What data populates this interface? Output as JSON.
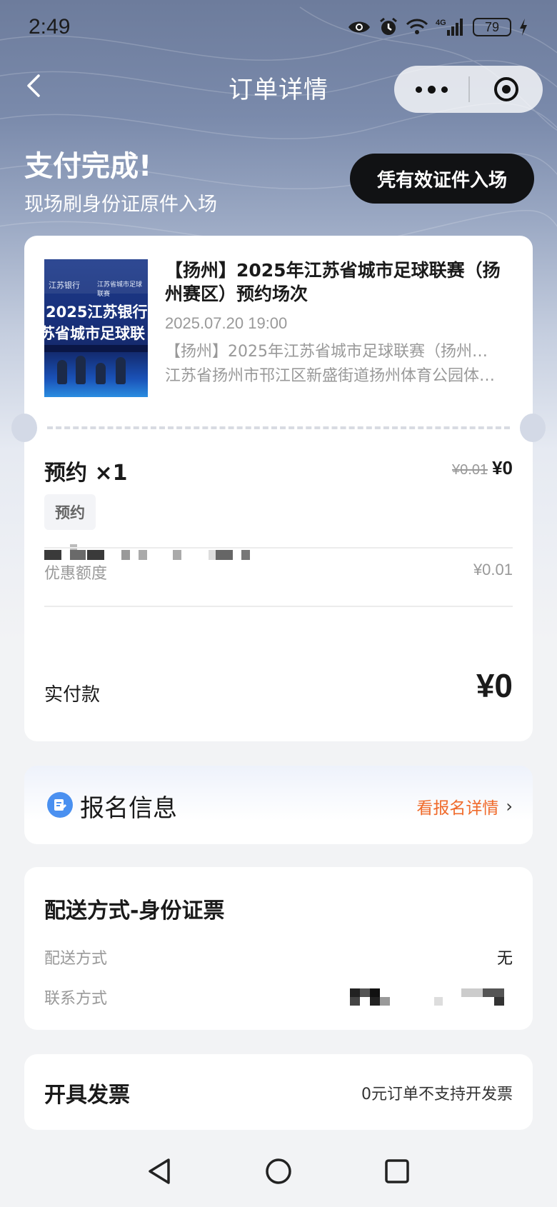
{
  "status_bar": {
    "time": "2:49",
    "battery": "79",
    "network": "4G"
  },
  "nav": {
    "title": "订单详情"
  },
  "hero": {
    "title": "支付完成!",
    "subtitle": "现场刷身份证原件入场",
    "entry_button": "凭有效证件入场"
  },
  "order": {
    "poster": {
      "bank": "江苏银行",
      "league": "江苏省城市足球联赛",
      "line1": "2025江苏银行",
      "line2": "苏省城市足球联"
    },
    "event_title": "【扬州】2025年江苏省城市足球联赛（扬州赛区）预约场次",
    "event_time": "2025.07.20 19:00",
    "event_name": "【扬州】2025年江苏省城市足球联赛（扬州赛区）预约场次",
    "event_address": "江苏省扬州市邗江区新盛街道扬州体育公园体育场",
    "item_name": "预约 ×1",
    "original_price": "¥0.01",
    "current_price": "¥0",
    "tag": "预约",
    "discount_label": "优惠额度",
    "discount_value": "¥0.01",
    "paid_label": "实付款",
    "paid_value": "¥0"
  },
  "registration": {
    "title": "报名信息",
    "link": "看报名详情"
  },
  "delivery": {
    "title": "配送方式-身份证票",
    "method_label": "配送方式",
    "method_value": "无",
    "contact_label": "联系方式"
  },
  "invoice": {
    "title": "开具发票",
    "value": "0元订单不支持开发票"
  },
  "colors": {
    "accent_orange": "#f06a2a",
    "dark_button": "#111214",
    "icon_blue": "#4a90f0"
  }
}
